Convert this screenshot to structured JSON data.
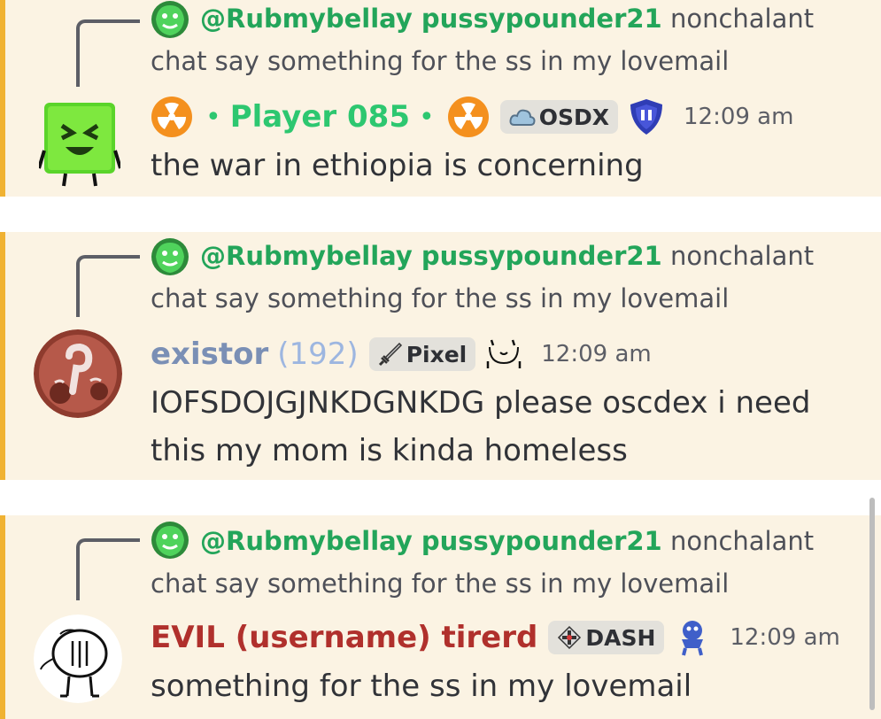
{
  "messages": [
    {
      "reply": {
        "mention": "@Rubmybellay pussypounder21",
        "preview_start": "nonchalant",
        "preview_rest": "chat say something for the ss in my lovemail"
      },
      "author": {
        "prefix_dot": "•",
        "name": "Player 085",
        "suffix_dot": "•",
        "name_color": "#2dc770",
        "icon_left": "radioactive-icon",
        "icon_right": "radioactive-icon"
      },
      "tag": {
        "icon": "cloud-icon",
        "label": "OSDX"
      },
      "badge_icon": "shield-face-icon",
      "timestamp": "12:09 am",
      "content": "the war in ethiopia is concerning"
    },
    {
      "reply": {
        "mention": "@Rubmybellay pussypounder21",
        "preview_start": "nonchalant",
        "preview_rest": "chat say something for the ss in my lovemail"
      },
      "author": {
        "name": "existor",
        "count": "(192)",
        "name_color": "#7a8fb5",
        "count_color": "#9db6e0"
      },
      "tag": {
        "icon": "sword-icon",
        "label": "Pixel"
      },
      "badge_icon": "doodle-face-icon",
      "timestamp": "12:09 am",
      "content": "IOFSDOJGJNKDGNKDG please oscdex i need this my mom is kinda homeless"
    },
    {
      "reply": {
        "mention": "@Rubmybellay pussypounder21",
        "preview_start": "nonchalant",
        "preview_rest": "chat say something for the ss in my lovemail"
      },
      "author": {
        "name": "EVIL (username) tirerd",
        "name_color": "#b0302c"
      },
      "tag": {
        "icon": "gamepad-icon",
        "label": "DASH"
      },
      "badge_icon": "blue-creature-icon",
      "timestamp": "12:09 am",
      "content": "something for the ss in my lovemail"
    }
  ]
}
